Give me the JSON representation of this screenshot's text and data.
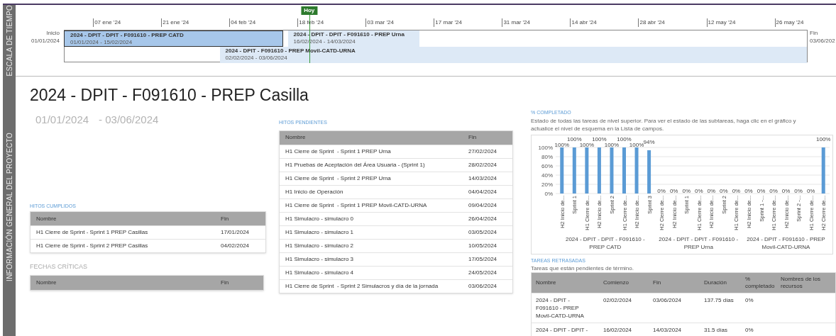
{
  "timeline": {
    "side_label": "ESCALA DE TIEMPO",
    "today_label": "Hoy",
    "start": {
      "label": "Inicio",
      "date": "01/01/2024"
    },
    "end": {
      "label": "Fin",
      "date": "03/06/202"
    },
    "ticks": [
      "07 ene '24",
      "21 ene '24",
      "04 feb '24",
      "18 feb '24",
      "03 mar '24",
      "17 mar '24",
      "31 mar '24",
      "14 abr '24",
      "28 abr '24",
      "12 may '24",
      "26 may '24"
    ],
    "bars": [
      {
        "title": "2024 - DPIT - DPIT - F091610 - PREP CATD",
        "dates": "01/01/2024 - 15/02/2024",
        "selected": true
      },
      {
        "title": "2024 - DPIT - DPIT - F091610 - PREP Urna",
        "dates": "16/02/2024 - 14/03/2024",
        "selected": false
      },
      {
        "title": "2024 - DPIT - F091610 - PREP Movil-CATD-URNA",
        "dates": "02/02/2024 - 03/06/2024",
        "selected": false
      }
    ]
  },
  "overview": {
    "side_label": "INFORMACIÓN GENERAL DEL PROYECTO",
    "title": "2024 - DPIT - F091610 - PREP Casilla",
    "start_date": "01/01/2024",
    "end_date": "- 03/06/2024",
    "completed_milestones": {
      "heading": "HITOS CUMPLIDOS",
      "columns": [
        "Nombre",
        "Fin"
      ],
      "rows": [
        [
          "H1 Cierre de Sprint - Sprint 1 PREP Casillas",
          "17/01/2024"
        ],
        [
          "H1 Cierre de Sprint - Sprint 2 PREP Casillas",
          "04/02/2024"
        ]
      ]
    },
    "critical_dates": {
      "heading": "FECHAS CRÍTICAS",
      "columns": [
        "Nombre",
        "Fin"
      ]
    },
    "pending_milestones": {
      "heading": "HITOS PENDIENTES",
      "columns": [
        "Nombre",
        "Fin"
      ],
      "rows": [
        [
          "H1 Cierre de Sprint  - Sprint 1 PREP Urna",
          "27/02/2024"
        ],
        [
          "H1 Pruebas de Aceptación del Área Usuaria - (Sprint 1)",
          "28/02/2024"
        ],
        [
          "H1 Cierre de Sprint  - Sprint 2 PREP Urna",
          "14/03/2024"
        ],
        [
          "H1 Inicio de Operación",
          "04/04/2024"
        ],
        [
          "H1 Cierre de Sprint  - Sprint 1 PREP Movil-CATD-URNA",
          "09/04/2024"
        ],
        [
          "H1 Simulacro - simulacro 0",
          "26/04/2024"
        ],
        [
          "H1 Simulacro - simulacro 1",
          "03/05/2024"
        ],
        [
          "H1 Simulacro - simulacro 2",
          "10/05/2024"
        ],
        [
          "H1 Simulacro - simulacro 3",
          "17/05/2024"
        ],
        [
          "H1 Simulacro - simulacro 4",
          "24/05/2024"
        ],
        [
          "H1 Cierre de Sprint  - Sprint 2 Simulacros y día de la jornada",
          "03/06/2024"
        ]
      ]
    },
    "percent_complete": {
      "heading": "% COMPLETADO",
      "description": "Estado de todas las tareas de nivel superior. Para ver el estado de las subtareas, haga clic en el gráfico y actualice el nivel de esquema en la Lista de campos.",
      "chart_groups": [
        "2024 - DPIT - DPIT - F091610 - PREP CATD",
        "2024 - DPIT - DPIT - F091610 - PREP Urna",
        "2024 - DPIT - F091610 - PREP Movil-CATD-URNA"
      ],
      "chart_data": {
        "type": "bar",
        "grid": true,
        "categories": [
          "H2 Inicio de...",
          "Sprint 1",
          "H1 Cierre de...",
          "H2 Inicio de...",
          "Sprint 2",
          "H1 Cierre de...",
          "H2 Inicio de...",
          "Sprint 3",
          "H2 Cierre de...",
          "H2 Inicio de...",
          "Sprint 1",
          "H1 Cierre de...",
          "H2 Inicio de...",
          "Sprint 2",
          "H1 Cierre de...",
          "H2 Inicio de...",
          "Sprint 1 -...",
          "H1 Cierre de...",
          "H2 Inicio de...",
          "Sprint 2 -...",
          "H1 Cierre de...",
          "H2 Cierre de..."
        ],
        "values": [
          100,
          100,
          100,
          100,
          100,
          100,
          100,
          94,
          0,
          0,
          0,
          0,
          0,
          0,
          0,
          0,
          0,
          0,
          0,
          0,
          0,
          100
        ],
        "value_labels": [
          "100%",
          "100%",
          "100%",
          "100%",
          "100%",
          "100%",
          "100%",
          "94%",
          "0%",
          "0%",
          "0%",
          "0%",
          "0%",
          "0%",
          "0%",
          "0%",
          "0%",
          "0%",
          "0%",
          "0%",
          "0%",
          "100%"
        ],
        "ylim": [
          0,
          100
        ],
        "yticks": [
          {
            "value": 0,
            "label": "0%"
          },
          {
            "value": 20,
            "label": "20%"
          },
          {
            "value": 40,
            "label": "40%"
          },
          {
            "value": 60,
            "label": "60%"
          },
          {
            "value": 80,
            "label": "80%"
          },
          {
            "value": 100,
            "label": "100%"
          }
        ]
      }
    },
    "late_tasks": {
      "heading": "TAREAS RETRASADAS",
      "description": "Tareas que están pendientes de término.",
      "columns": [
        "Nombre",
        "Comienzo",
        "Fin",
        "Duración",
        "% completado",
        "Nombres de los recursos"
      ],
      "rows": [
        [
          "2024 - DPIT - F091610 - PREP Movil-CATD-URNA",
          "02/02/2024",
          "03/06/2024",
          "137.75 días",
          "0%"
        ],
        [
          "2024 - DPIT - DPIT -",
          "16/02/2024",
          "14/03/2024",
          "31.5 días",
          "0%"
        ]
      ]
    }
  }
}
